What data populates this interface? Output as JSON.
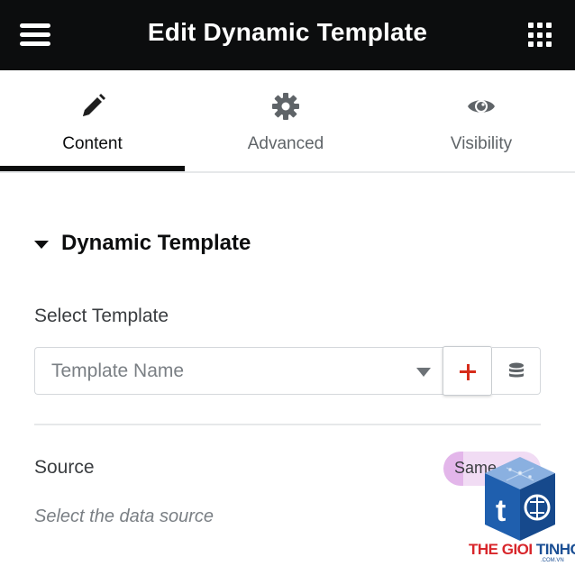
{
  "header": {
    "title": "Edit Dynamic Template",
    "background": "#0c0d0e"
  },
  "tabs": [
    {
      "label": "Content",
      "icon": "pencil-icon",
      "active": true
    },
    {
      "label": "Advanced",
      "icon": "gear-icon",
      "active": false
    },
    {
      "label": "Visibility",
      "icon": "eye-icon",
      "active": false
    }
  ],
  "section": {
    "title": "Dynamic Template",
    "expanded": true
  },
  "select_template": {
    "label": "Select Template",
    "placeholder": "Template Name",
    "add_icon": "plus-icon",
    "library_icon": "database-icon",
    "accent": "#d62c1a"
  },
  "source": {
    "label": "Source",
    "value": "Same",
    "help": "Select the data source"
  },
  "watermark": {
    "brand_red": "THE GIOI",
    "brand_blue": "TINHOC",
    "domain": ".COM.VN"
  }
}
